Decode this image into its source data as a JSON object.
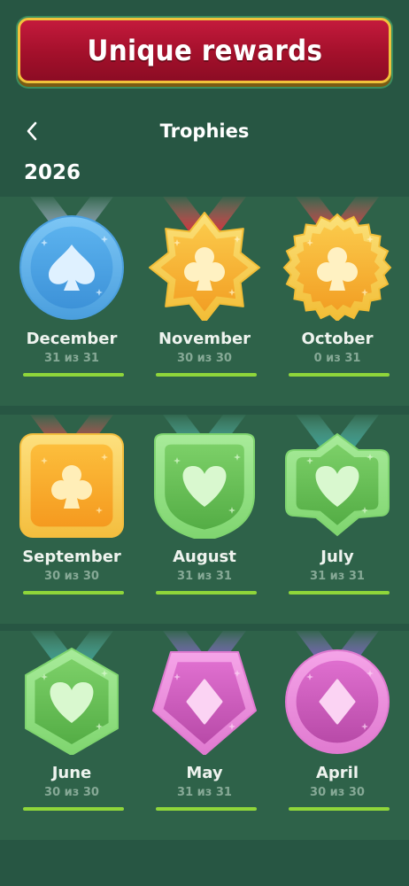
{
  "banner": {
    "text": "Unique rewards"
  },
  "header": {
    "title": "Trophies",
    "back_icon": "chevron-left-icon"
  },
  "year": "2026",
  "trophies": [
    {
      "month": "December",
      "progress": "31 из 31",
      "shape": "circle",
      "suit": "spade",
      "theme": "blue",
      "ribbon": "silver",
      "bar_fill": 1.0
    },
    {
      "month": "November",
      "progress": "30 из 30",
      "shape": "star",
      "suit": "club",
      "theme": "gold",
      "ribbon": "red",
      "bar_fill": 1.0
    },
    {
      "month": "October",
      "progress": "0 из 31",
      "shape": "seal",
      "suit": "club",
      "theme": "gold",
      "ribbon": "red",
      "bar_fill": 1.0
    },
    {
      "month": "September",
      "progress": "30 из 30",
      "shape": "square",
      "suit": "club",
      "theme": "orange",
      "ribbon": "red",
      "bar_fill": 1.0
    },
    {
      "month": "August",
      "progress": "31 из 31",
      "shape": "shield",
      "suit": "heart",
      "theme": "green",
      "ribbon": "teal",
      "bar_fill": 1.0
    },
    {
      "month": "July",
      "progress": "31 из 31",
      "shape": "badge",
      "suit": "heart",
      "theme": "green",
      "ribbon": "teal",
      "bar_fill": 1.0
    },
    {
      "month": "June",
      "progress": "30 из 30",
      "shape": "hexagon",
      "suit": "heart",
      "theme": "green",
      "ribbon": "teal",
      "bar_fill": 1.0
    },
    {
      "month": "May",
      "progress": "31 из 31",
      "shape": "pentagon",
      "suit": "diamond",
      "theme": "pink",
      "ribbon": "purple",
      "bar_fill": 1.0
    },
    {
      "month": "April",
      "progress": "30 из 30",
      "shape": "circle",
      "suit": "diamond",
      "theme": "pink",
      "ribbon": "purple",
      "bar_fill": 1.0
    }
  ],
  "colors": {
    "background": "#275643",
    "row_band": "#2e6249",
    "banner_red": "#a3102b",
    "banner_border": "#f1c23b",
    "progress_bar": "#8fd63a"
  }
}
